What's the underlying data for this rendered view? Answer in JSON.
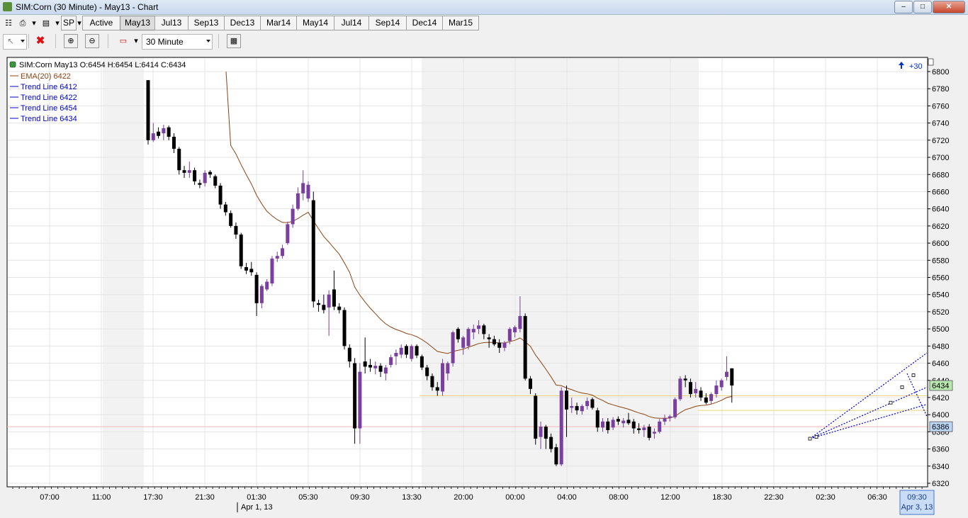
{
  "window": {
    "title": "SIM:Corn (30 Minute) - May13 - Chart",
    "controls": [
      "minimize",
      "maximize",
      "close"
    ]
  },
  "toolbar": {
    "instrument_button": "SP",
    "tabs": [
      {
        "label": "Active",
        "selected": false
      },
      {
        "label": "May13",
        "selected": true
      },
      {
        "label": "Jul13",
        "selected": false
      },
      {
        "label": "Sep13",
        "selected": false
      },
      {
        "label": "Dec13",
        "selected": false
      },
      {
        "label": "Mar14",
        "selected": false
      },
      {
        "label": "May14",
        "selected": false
      },
      {
        "label": "Jul14",
        "selected": false
      },
      {
        "label": "Sep14",
        "selected": false
      },
      {
        "label": "Dec14",
        "selected": false
      },
      {
        "label": "Mar15",
        "selected": false
      }
    ],
    "period": "30 Minute",
    "icons": [
      "print-icon",
      "data-series-icon",
      "pointer-icon",
      "delete-icon",
      "zoom-in-icon",
      "zoom-out-icon",
      "chart-style-icon",
      "properties-icon"
    ]
  },
  "chart": {
    "header": "SIM:Corn May13 O:6454 H:6454 L:6414 C:6434",
    "scroll_label": "+30",
    "legend": [
      {
        "label": "EMA(20)  6422",
        "color": "#8b4513"
      },
      {
        "label": "Trend Line  6412",
        "color": "#0000cc"
      },
      {
        "label": "Trend Line  6422",
        "color": "#0000cc"
      },
      {
        "label": "Trend Line  6454",
        "color": "#0000cc"
      },
      {
        "label": "Trend Line  6434",
        "color": "#0000cc"
      }
    ],
    "price_marker_last": "6434",
    "price_marker_ref": "6386",
    "date_label": "Apr 1, 13",
    "cursor_label_time": "09:30",
    "cursor_label_date": "Apr 3, 13",
    "colors": {
      "up": "#7b3fa0",
      "down": "#000000",
      "ema": "#8b4513",
      "trend": "#0000cc",
      "last_bg": "#b9e7b0",
      "ref_bg": "#bcd6f7"
    }
  },
  "chart_data": {
    "type": "candlestick",
    "series_name": "SIM:Corn May13",
    "ylim": [
      6320,
      6800
    ],
    "y_ticks": [
      6320,
      6340,
      6360,
      6380,
      6400,
      6420,
      6440,
      6460,
      6480,
      6500,
      6520,
      6540,
      6560,
      6580,
      6600,
      6620,
      6640,
      6660,
      6680,
      6700,
      6720,
      6740,
      6760,
      6780,
      6800
    ],
    "x_ticks": [
      "07:00",
      "11:00",
      "17:30",
      "21:30",
      "01:30",
      "05:30",
      "09:30",
      "13:30",
      "20:00",
      "00:00",
      "04:00",
      "08:00",
      "12:00",
      "18:30",
      "22:30",
      "02:30",
      "06:30"
    ],
    "candles": [
      {
        "o": 6790,
        "h": 6790,
        "l": 6715,
        "c": 6720
      },
      {
        "o": 6720,
        "h": 6740,
        "l": 6718,
        "c": 6728
      },
      {
        "o": 6730,
        "h": 6735,
        "l": 6722,
        "c": 6725
      },
      {
        "o": 6728,
        "h": 6738,
        "l": 6720,
        "c": 6734
      },
      {
        "o": 6735,
        "h": 6737,
        "l": 6720,
        "c": 6724
      },
      {
        "o": 6724,
        "h": 6728,
        "l": 6705,
        "c": 6710
      },
      {
        "o": 6710,
        "h": 6712,
        "l": 6680,
        "c": 6685
      },
      {
        "o": 6685,
        "h": 6690,
        "l": 6676,
        "c": 6682
      },
      {
        "o": 6682,
        "h": 6695,
        "l": 6676,
        "c": 6685
      },
      {
        "o": 6685,
        "h": 6688,
        "l": 6668,
        "c": 6672
      },
      {
        "o": 6670,
        "h": 6674,
        "l": 6664,
        "c": 6668
      },
      {
        "o": 6670,
        "h": 6685,
        "l": 6666,
        "c": 6682
      },
      {
        "o": 6683,
        "h": 6685,
        "l": 6676,
        "c": 6680
      },
      {
        "o": 6678,
        "h": 6680,
        "l": 6664,
        "c": 6667
      },
      {
        "o": 6667,
        "h": 6670,
        "l": 6640,
        "c": 6645
      },
      {
        "o": 6645,
        "h": 6648,
        "l": 6632,
        "c": 6636
      },
      {
        "o": 6635,
        "h": 6638,
        "l": 6618,
        "c": 6620
      },
      {
        "o": 6620,
        "h": 6624,
        "l": 6605,
        "c": 6610
      },
      {
        "o": 6610,
        "h": 6612,
        "l": 6570,
        "c": 6573
      },
      {
        "o": 6572,
        "h": 6577,
        "l": 6564,
        "c": 6568
      },
      {
        "o": 6570,
        "h": 6578,
        "l": 6562,
        "c": 6566
      },
      {
        "o": 6563,
        "h": 6566,
        "l": 6515,
        "c": 6530
      },
      {
        "o": 6530,
        "h": 6552,
        "l": 6524,
        "c": 6550
      },
      {
        "o": 6546,
        "h": 6558,
        "l": 6544,
        "c": 6555
      },
      {
        "o": 6553,
        "h": 6585,
        "l": 6550,
        "c": 6582
      },
      {
        "o": 6582,
        "h": 6590,
        "l": 6578,
        "c": 6585
      },
      {
        "o": 6585,
        "h": 6598,
        "l": 6582,
        "c": 6594
      },
      {
        "o": 6600,
        "h": 6625,
        "l": 6598,
        "c": 6622
      },
      {
        "o": 6622,
        "h": 6645,
        "l": 6618,
        "c": 6640
      },
      {
        "o": 6640,
        "h": 6665,
        "l": 6638,
        "c": 6658
      },
      {
        "o": 6658,
        "h": 6685,
        "l": 6650,
        "c": 6670
      },
      {
        "o": 6652,
        "h": 6672,
        "l": 6648,
        "c": 6668
      },
      {
        "o": 6650,
        "h": 6660,
        "l": 6525,
        "c": 6532
      },
      {
        "o": 6530,
        "h": 6534,
        "l": 6520,
        "c": 6528
      },
      {
        "o": 6528,
        "h": 6540,
        "l": 6518,
        "c": 6522
      },
      {
        "o": 6525,
        "h": 6545,
        "l": 6492,
        "c": 6540
      },
      {
        "o": 6546,
        "h": 6568,
        "l": 6522,
        "c": 6526
      },
      {
        "o": 6526,
        "h": 6530,
        "l": 6518,
        "c": 6522
      },
      {
        "o": 6522,
        "h": 6525,
        "l": 6476,
        "c": 6480
      },
      {
        "o": 6478,
        "h": 6482,
        "l": 6455,
        "c": 6462
      },
      {
        "o": 6460,
        "h": 6466,
        "l": 6366,
        "c": 6384
      },
      {
        "o": 6384,
        "h": 6460,
        "l": 6366,
        "c": 6450
      },
      {
        "o": 6462,
        "h": 6490,
        "l": 6448,
        "c": 6456
      },
      {
        "o": 6458,
        "h": 6465,
        "l": 6450,
        "c": 6455
      },
      {
        "o": 6454,
        "h": 6462,
        "l": 6447,
        "c": 6457
      },
      {
        "o": 6457,
        "h": 6460,
        "l": 6444,
        "c": 6450
      },
      {
        "o": 6448,
        "h": 6458,
        "l": 6440,
        "c": 6455
      },
      {
        "o": 6458,
        "h": 6470,
        "l": 6455,
        "c": 6467
      },
      {
        "o": 6468,
        "h": 6476,
        "l": 6458,
        "c": 6472
      },
      {
        "o": 6470,
        "h": 6482,
        "l": 6466,
        "c": 6478
      },
      {
        "o": 6480,
        "h": 6482,
        "l": 6466,
        "c": 6470
      },
      {
        "o": 6465,
        "h": 6482,
        "l": 6462,
        "c": 6480
      },
      {
        "o": 6480,
        "h": 6482,
        "l": 6466,
        "c": 6469
      },
      {
        "o": 6468,
        "h": 6470,
        "l": 6452,
        "c": 6455
      },
      {
        "o": 6455,
        "h": 6458,
        "l": 6440,
        "c": 6445
      },
      {
        "o": 6445,
        "h": 6448,
        "l": 6428,
        "c": 6432
      },
      {
        "o": 6432,
        "h": 6438,
        "l": 6422,
        "c": 6428
      },
      {
        "o": 6427,
        "h": 6465,
        "l": 6422,
        "c": 6460
      },
      {
        "o": 6448,
        "h": 6462,
        "l": 6440,
        "c": 6460
      },
      {
        "o": 6460,
        "h": 6498,
        "l": 6456,
        "c": 6496
      },
      {
        "o": 6500,
        "h": 6502,
        "l": 6484,
        "c": 6488
      },
      {
        "o": 6478,
        "h": 6492,
        "l": 6470,
        "c": 6490
      },
      {
        "o": 6480,
        "h": 6502,
        "l": 6476,
        "c": 6500
      },
      {
        "o": 6496,
        "h": 6505,
        "l": 6488,
        "c": 6500
      },
      {
        "o": 6500,
        "h": 6510,
        "l": 6494,
        "c": 6504
      },
      {
        "o": 6504,
        "h": 6506,
        "l": 6488,
        "c": 6494
      },
      {
        "o": 6490,
        "h": 6494,
        "l": 6478,
        "c": 6488
      },
      {
        "o": 6488,
        "h": 6492,
        "l": 6480,
        "c": 6482
      },
      {
        "o": 6484,
        "h": 6488,
        "l": 6472,
        "c": 6478
      },
      {
        "o": 6478,
        "h": 6486,
        "l": 6474,
        "c": 6484
      },
      {
        "o": 6486,
        "h": 6502,
        "l": 6482,
        "c": 6500
      },
      {
        "o": 6496,
        "h": 6504,
        "l": 6490,
        "c": 6502
      },
      {
        "o": 6500,
        "h": 6538,
        "l": 6496,
        "c": 6515
      },
      {
        "o": 6515,
        "h": 6518,
        "l": 6440,
        "c": 6442
      },
      {
        "o": 6442,
        "h": 6445,
        "l": 6424,
        "c": 6430
      },
      {
        "o": 6422,
        "h": 6425,
        "l": 6365,
        "c": 6372
      },
      {
        "o": 6374,
        "h": 6392,
        "l": 6360,
        "c": 6386
      },
      {
        "o": 6386,
        "h": 6388,
        "l": 6360,
        "c": 6372
      },
      {
        "o": 6374,
        "h": 6378,
        "l": 6356,
        "c": 6360
      },
      {
        "o": 6362,
        "h": 6366,
        "l": 6340,
        "c": 6342
      },
      {
        "o": 6342,
        "h": 6432,
        "l": 6340,
        "c": 6428
      },
      {
        "o": 6428,
        "h": 6434,
        "l": 6374,
        "c": 6406
      },
      {
        "o": 6408,
        "h": 6420,
        "l": 6402,
        "c": 6410
      },
      {
        "o": 6410,
        "h": 6414,
        "l": 6400,
        "c": 6405
      },
      {
        "o": 6404,
        "h": 6412,
        "l": 6400,
        "c": 6410
      },
      {
        "o": 6410,
        "h": 6420,
        "l": 6406,
        "c": 6416
      },
      {
        "o": 6418,
        "h": 6420,
        "l": 6406,
        "c": 6408
      },
      {
        "o": 6405,
        "h": 6408,
        "l": 6380,
        "c": 6385
      },
      {
        "o": 6385,
        "h": 6396,
        "l": 6380,
        "c": 6392
      },
      {
        "o": 6392,
        "h": 6396,
        "l": 6378,
        "c": 6382
      },
      {
        "o": 6385,
        "h": 6397,
        "l": 6382,
        "c": 6394
      },
      {
        "o": 6395,
        "h": 6398,
        "l": 6388,
        "c": 6392
      },
      {
        "o": 6390,
        "h": 6396,
        "l": 6385,
        "c": 6393
      },
      {
        "o": 6394,
        "h": 6402,
        "l": 6388,
        "c": 6390
      },
      {
        "o": 6392,
        "h": 6395,
        "l": 6378,
        "c": 6384
      },
      {
        "o": 6384,
        "h": 6390,
        "l": 6378,
        "c": 6382
      },
      {
        "o": 6382,
        "h": 6388,
        "l": 6374,
        "c": 6385
      },
      {
        "o": 6386,
        "h": 6389,
        "l": 6370,
        "c": 6373
      },
      {
        "o": 6378,
        "h": 6384,
        "l": 6372,
        "c": 6380
      },
      {
        "o": 6380,
        "h": 6395,
        "l": 6378,
        "c": 6392
      },
      {
        "o": 6392,
        "h": 6400,
        "l": 6388,
        "c": 6396
      },
      {
        "o": 6396,
        "h": 6400,
        "l": 6392,
        "c": 6398
      },
      {
        "o": 6397,
        "h": 6420,
        "l": 6395,
        "c": 6418
      },
      {
        "o": 6418,
        "h": 6445,
        "l": 6416,
        "c": 6442
      },
      {
        "o": 6442,
        "h": 6446,
        "l": 6432,
        "c": 6440
      },
      {
        "o": 6438,
        "h": 6442,
        "l": 6420,
        "c": 6424
      },
      {
        "o": 6425,
        "h": 6438,
        "l": 6420,
        "c": 6430
      },
      {
        "o": 6428,
        "h": 6432,
        "l": 6416,
        "c": 6420
      },
      {
        "o": 6420,
        "h": 6425,
        "l": 6412,
        "c": 6414
      },
      {
        "o": 6416,
        "h": 6426,
        "l": 6412,
        "c": 6424
      },
      {
        "o": 6424,
        "h": 6440,
        "l": 6420,
        "c": 6434
      },
      {
        "o": 6432,
        "h": 6442,
        "l": 6428,
        "c": 6440
      },
      {
        "o": 6444,
        "h": 6468,
        "l": 6440,
        "c": 6450
      },
      {
        "o": 6454,
        "h": 6454,
        "l": 6414,
        "c": 6434
      }
    ],
    "ema_label": "EMA(20)",
    "ema_last": 6422,
    "trend_lines": [
      {
        "label": "Trend Line",
        "value": 6412
      },
      {
        "label": "Trend Line",
        "value": 6422
      },
      {
        "label": "Trend Line",
        "value": 6454
      },
      {
        "label": "Trend Line",
        "value": 6434
      }
    ],
    "last_price": 6434,
    "reference_price": 6386
  }
}
